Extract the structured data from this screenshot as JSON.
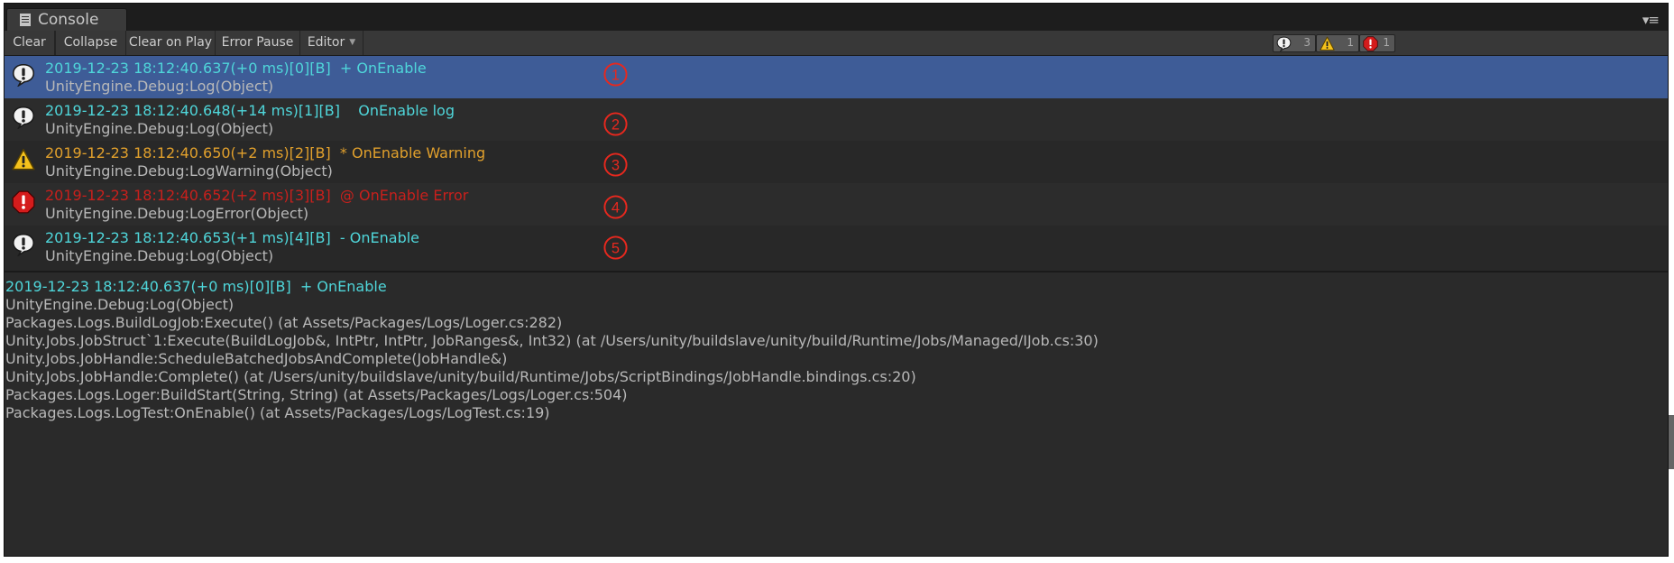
{
  "tab": {
    "title": "Console"
  },
  "toolbar": {
    "clear": "Clear",
    "collapse": "Collapse",
    "clear_on_play": "Clear on Play",
    "error_pause": "Error Pause",
    "editor": "Editor"
  },
  "counters": {
    "log": "3",
    "warning": "1",
    "error": "1"
  },
  "colors": {
    "log_text": "#4fd6da",
    "warning_text": "#e1a02c",
    "error_text": "#c8201c",
    "selected_row": "#3e5c97",
    "badge": "#e8281e"
  },
  "entries": [
    {
      "type": "log",
      "icon": "info-icon",
      "line1": "2019-12-23 18:12:40.637(+0 ms)[0][B]  + OnEnable",
      "line2": "UnityEngine.Debug:Log(Object)",
      "badge": "①",
      "selected": true
    },
    {
      "type": "log",
      "icon": "info-icon",
      "line1": "2019-12-23 18:12:40.648(+14 ms)[1][B]    OnEnable log",
      "line2": "UnityEngine.Debug:Log(Object)",
      "badge": "②",
      "selected": false
    },
    {
      "type": "warning",
      "icon": "warning-icon",
      "line1": "2019-12-23 18:12:40.650(+2 ms)[2][B]  * OnEnable Warning",
      "line2": "UnityEngine.Debug:LogWarning(Object)",
      "badge": "③",
      "selected": false
    },
    {
      "type": "error",
      "icon": "error-icon",
      "line1": "2019-12-23 18:12:40.652(+2 ms)[3][B]  @ OnEnable Error",
      "line2": "UnityEngine.Debug:LogError(Object)",
      "badge": "④",
      "selected": false
    },
    {
      "type": "log",
      "icon": "info-icon",
      "line1": "2019-12-23 18:12:40.653(+1 ms)[4][B]  - OnEnable",
      "line2": "UnityEngine.Debug:Log(Object)",
      "badge": "⑤",
      "selected": false
    }
  ],
  "detail": {
    "header": "2019-12-23 18:12:40.637(+0 ms)[0][B]  + OnEnable",
    "stack": [
      "UnityEngine.Debug:Log(Object)",
      "Packages.Logs.BuildLogJob:Execute() (at Assets/Packages/Logs/Loger.cs:282)",
      "Unity.Jobs.JobStruct`1:Execute(BuildLogJob&, IntPtr, IntPtr, JobRanges&, Int32) (at /Users/unity/buildslave/unity/build/Runtime/Jobs/Managed/IJob.cs:30)",
      "Unity.Jobs.JobHandle:ScheduleBatchedJobsAndComplete(JobHandle&)",
      "Unity.Jobs.JobHandle:Complete() (at /Users/unity/buildslave/unity/build/Runtime/Jobs/ScriptBindings/JobHandle.bindings.cs:20)",
      "Packages.Logs.Loger:BuildStart(String, String) (at Assets/Packages/Logs/Loger.cs:504)",
      "Packages.Logs.LogTest:OnEnable() (at Assets/Packages/Logs/LogTest.cs:19)"
    ]
  }
}
